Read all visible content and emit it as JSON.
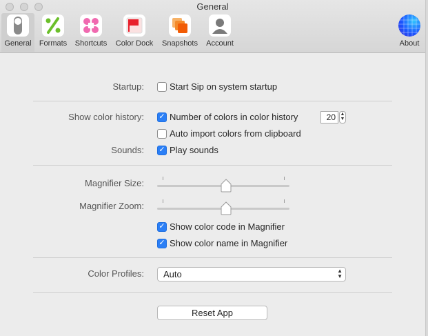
{
  "window": {
    "title": "General"
  },
  "toolbar": {
    "items": [
      {
        "label": "General",
        "icon": "switch-icon"
      },
      {
        "label": "Formats",
        "icon": "percent-icon"
      },
      {
        "label": "Shortcuts",
        "icon": "command-icon"
      },
      {
        "label": "Color Dock",
        "icon": "color-dock-icon"
      },
      {
        "label": "Snapshots",
        "icon": "snapshots-icon"
      },
      {
        "label": "Account",
        "icon": "account-icon"
      },
      {
        "label": "About",
        "icon": "sip-logo-icon"
      }
    ],
    "active": "General"
  },
  "startup": {
    "label": "Startup:",
    "option": "Start Sip on system startup",
    "checked": false
  },
  "history": {
    "label": "Show color history:",
    "count_option": "Number of colors in color history",
    "count_checked": true,
    "count_value": "20",
    "auto_import_option": "Auto import colors from clipboard",
    "auto_import_checked": false
  },
  "sounds": {
    "label": "Sounds:",
    "option": "Play sounds",
    "checked": true
  },
  "magnifier": {
    "size_label": "Magnifier Size:",
    "size_value": 0.5,
    "zoom_label": "Magnifier Zoom:",
    "zoom_value": 0.5,
    "show_code_option": "Show color code in Magnifier",
    "show_code_checked": true,
    "show_name_option": "Show color name in Magnifier",
    "show_name_checked": true
  },
  "profiles": {
    "label": "Color Profiles:",
    "selected": "Auto"
  },
  "reset": {
    "label": "Reset App"
  },
  "colors": {
    "accent": "#2b7ff6",
    "background": "#ececec"
  }
}
